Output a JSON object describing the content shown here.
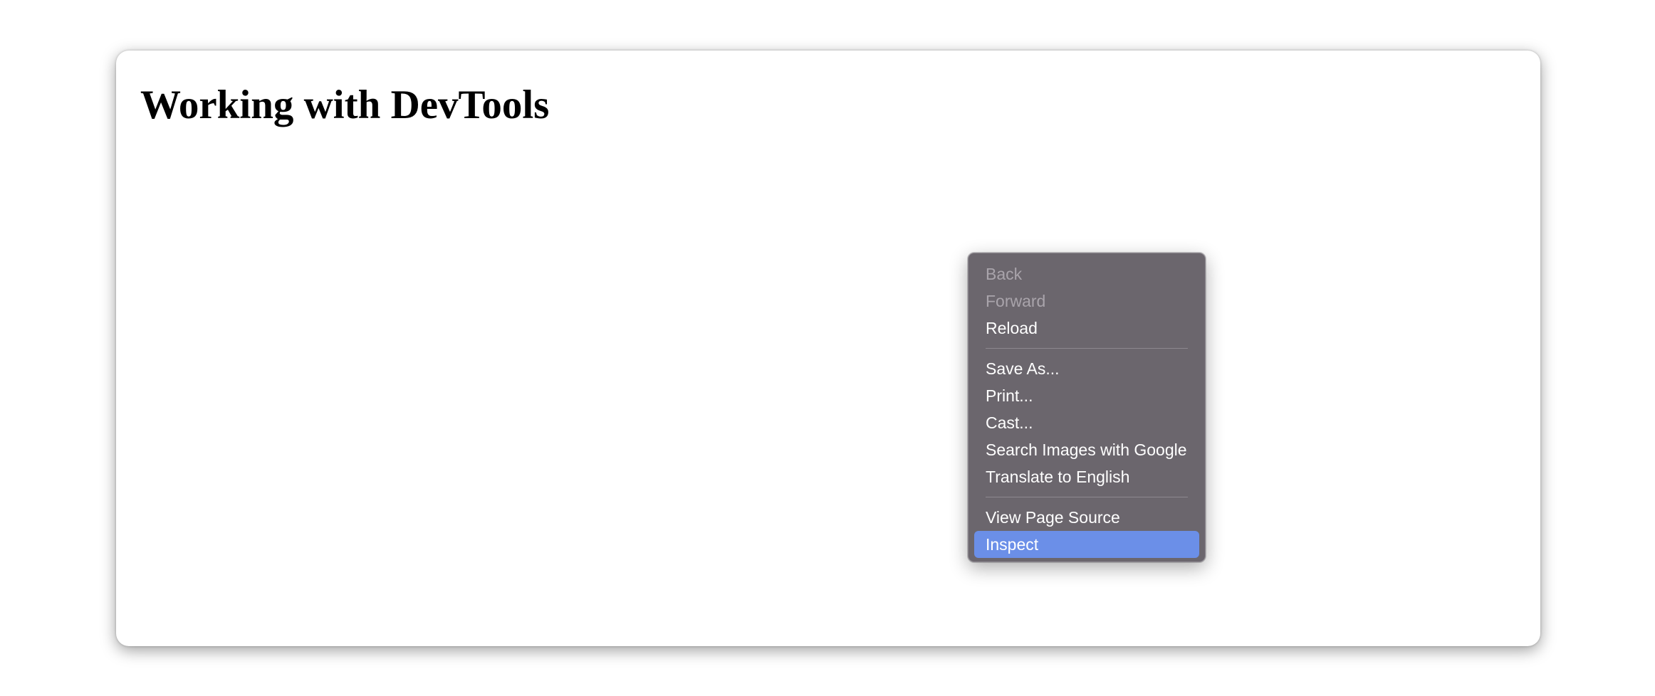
{
  "page": {
    "title": "Working with DevTools"
  },
  "context_menu": {
    "groups": [
      {
        "items": [
          {
            "label": "Back",
            "enabled": false
          },
          {
            "label": "Forward",
            "enabled": false
          },
          {
            "label": "Reload",
            "enabled": true
          }
        ]
      },
      {
        "items": [
          {
            "label": "Save As...",
            "enabled": true
          },
          {
            "label": "Print...",
            "enabled": true
          },
          {
            "label": "Cast...",
            "enabled": true
          },
          {
            "label": "Search Images with Google",
            "enabled": true
          },
          {
            "label": "Translate to English",
            "enabled": true
          }
        ]
      },
      {
        "items": [
          {
            "label": "View Page Source",
            "enabled": true
          },
          {
            "label": "Inspect",
            "enabled": true,
            "highlighted": true
          }
        ]
      }
    ]
  },
  "colors": {
    "menu_background": "#6b666d",
    "menu_highlight": "#6b8fe8",
    "menu_text": "#ffffff",
    "menu_text_disabled": "#a9a4ab"
  }
}
